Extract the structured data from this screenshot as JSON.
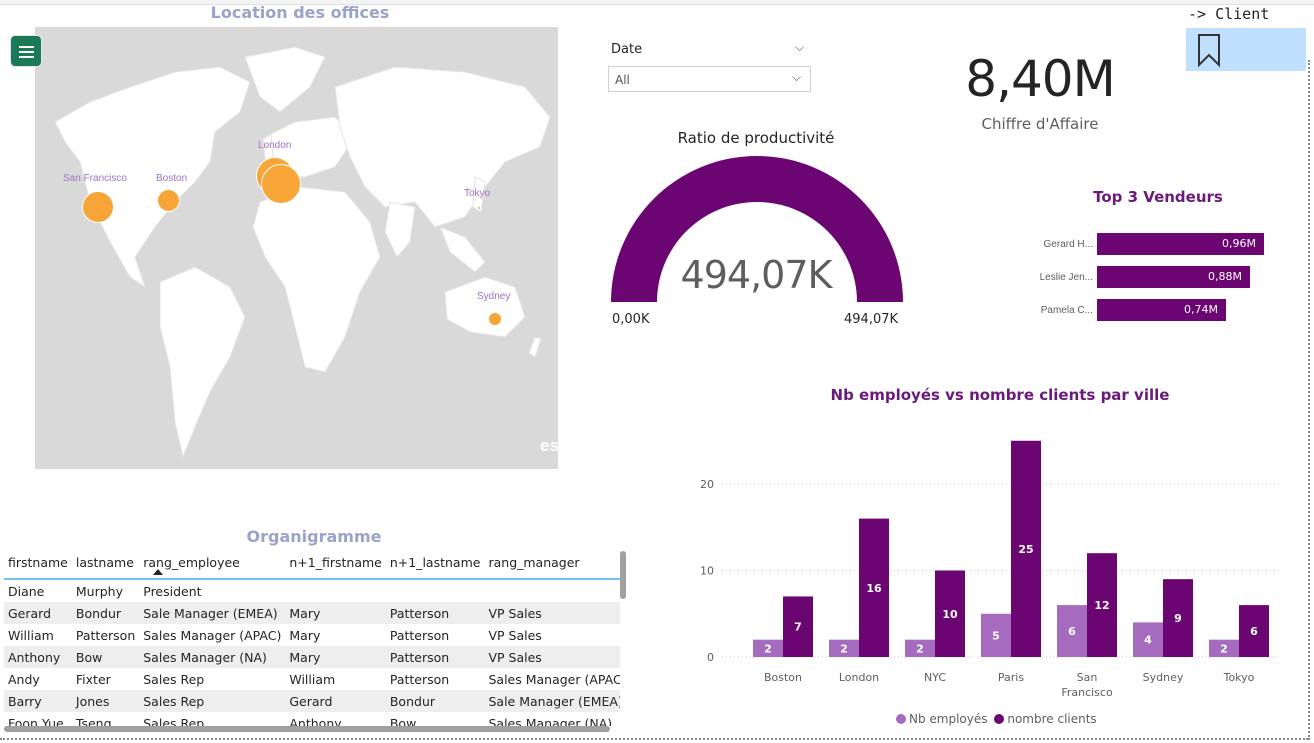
{
  "map": {
    "title": "Location des offices",
    "watermark": "esri",
    "cities": [
      {
        "name": "San Francisco"
      },
      {
        "name": "Boston"
      },
      {
        "name": "London"
      },
      {
        "name": "Tokyo"
      },
      {
        "name": "Sydney"
      }
    ]
  },
  "menu": {
    "icon": "hamburger-menu-icon"
  },
  "date_slicer": {
    "label": "Date",
    "selected": "All"
  },
  "kpi": {
    "value": "8,40M",
    "label": "Chiffre d'Affaire"
  },
  "nav": {
    "client_link": "-> Client",
    "bookmark_icon": "bookmark-icon"
  },
  "gauge": {
    "title": "Ratio de productivité",
    "value": "494,07K",
    "min": "0,00K",
    "max": "494,07K",
    "fill_fraction": 1.0,
    "color": "#6a0572"
  },
  "top3": {
    "title": "Top 3 Vendeurs",
    "sellers": [
      {
        "name": "Gerard H...",
        "value": 0.96,
        "label": "0,96M"
      },
      {
        "name": "Leslie Jen...",
        "value": 0.88,
        "label": "0,88M"
      },
      {
        "name": "Pamela C...",
        "value": 0.74,
        "label": "0,74M"
      }
    ]
  },
  "org": {
    "title": "Organigramme",
    "columns": [
      "firstname",
      "lastname",
      "rang_employee",
      "n+1_firstname",
      "n+1_lastname",
      "rang_manager"
    ],
    "rows": [
      [
        "Diane",
        "Murphy",
        "President",
        "",
        "",
        ""
      ],
      [
        "Gerard",
        "Bondur",
        "Sale Manager (EMEA)",
        "Mary",
        "Patterson",
        "VP Sales"
      ],
      [
        "William",
        "Patterson",
        "Sales Manager (APAC)",
        "Mary",
        "Patterson",
        "VP Sales"
      ],
      [
        "Anthony",
        "Bow",
        "Sales Manager (NA)",
        "Mary",
        "Patterson",
        "VP Sales"
      ],
      [
        "Andy",
        "Fixter",
        "Sales Rep",
        "William",
        "Patterson",
        "Sales Manager (APAC)"
      ],
      [
        "Barry",
        "Jones",
        "Sales Rep",
        "Gerard",
        "Bondur",
        "Sale Manager (EMEA)"
      ],
      [
        "Foon Yue",
        "Tseng",
        "Sales Rep",
        "Anthony",
        "Bow",
        "Sales Manager (NA)"
      ]
    ]
  },
  "chart_data": {
    "type": "bar",
    "title": "Nb employés vs nombre clients par ville",
    "categories": [
      "Boston",
      "London",
      "NYC",
      "Paris",
      "San Francisco",
      "Sydney",
      "Tokyo"
    ],
    "series": [
      {
        "name": "Nb employés",
        "values": [
          2,
          2,
          2,
          5,
          6,
          4,
          2
        ],
        "color": "#a66bbf"
      },
      {
        "name": "nombre clients",
        "values": [
          7,
          16,
          10,
          25,
          12,
          9,
          6
        ],
        "color": "#6a0572"
      }
    ],
    "yticks": [
      0,
      10,
      20
    ],
    "ylim": [
      0,
      26
    ],
    "legend": "bottom",
    "grid": true
  }
}
